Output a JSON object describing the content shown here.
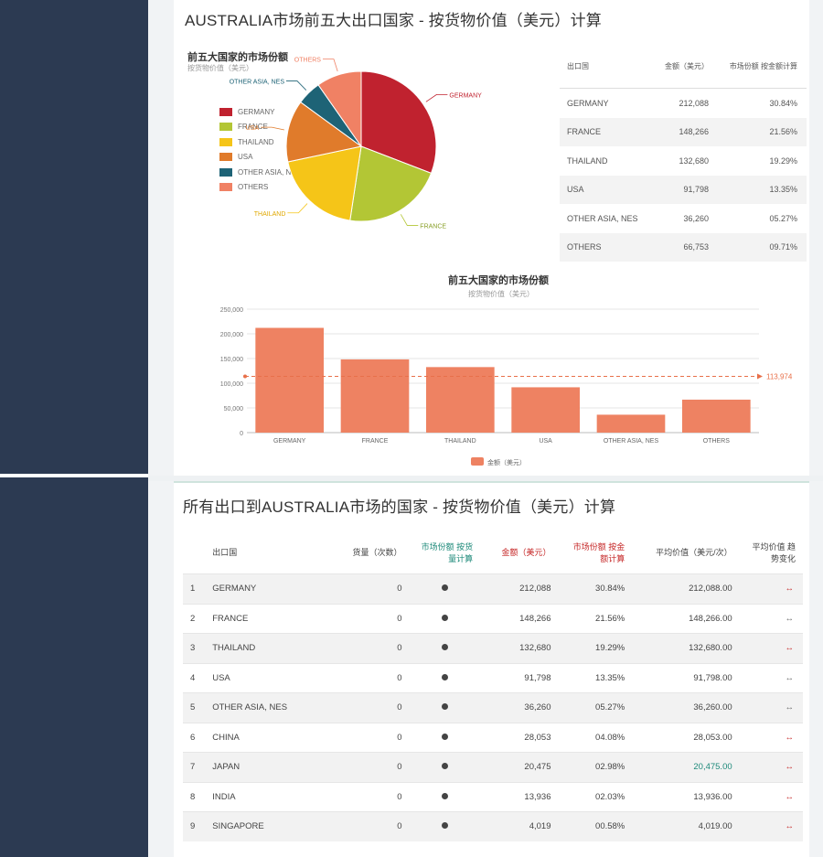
{
  "top_card": {
    "title": "AUSTRALIA市场前五大出口国家 - 按货物价值（美元）计算"
  },
  "pie": {
    "title": "前五大国家的市场份额",
    "subtitle": "按货物价值（美元）",
    "legend": [
      {
        "name": "GERMANY",
        "color": "#c0222f"
      },
      {
        "name": "FRANCE",
        "color": "#b3c635"
      },
      {
        "name": "THAILAND",
        "color": "#f5c518"
      },
      {
        "name": "USA",
        "color": "#e07b2b"
      },
      {
        "name": "OTHER ASIA, NES",
        "color": "#1e6376"
      },
      {
        "name": "OTHERS",
        "color": "#f08164"
      }
    ],
    "slice_labels": {
      "germany": "GERMANY",
      "france": "FRANCE",
      "thailand": "THAILAND",
      "usa": "USA",
      "other_asia": "OTHER ASIA, NES",
      "others": "OTHERS"
    }
  },
  "share_table": {
    "headers": {
      "country": "出口国",
      "value": "金额（美元）",
      "share": "市场份额 按金额计算"
    },
    "rows": [
      {
        "country": "GERMANY",
        "value": "212,088",
        "share": "30.84%"
      },
      {
        "country": "FRANCE",
        "value": "148,266",
        "share": "21.56%"
      },
      {
        "country": "THAILAND",
        "value": "132,680",
        "share": "19.29%"
      },
      {
        "country": "USA",
        "value": "91,798",
        "share": "13.35%"
      },
      {
        "country": "OTHER ASIA, NES",
        "value": "36,260",
        "share": "05.27%"
      },
      {
        "country": "OTHERS",
        "value": "66,753",
        "share": "09.71%"
      }
    ]
  },
  "bar": {
    "title": "前五大国家的市场份额",
    "subtitle": "按货物价值（美元）",
    "avg_label": "113,974",
    "legend_label": "金额（美元）",
    "color": "#ee8262"
  },
  "chart_data": {
    "type": "bar",
    "categories": [
      "GERMANY",
      "FRANCE",
      "THAILAND",
      "USA",
      "OTHER ASIA, NES",
      "OTHERS"
    ],
    "series": [
      {
        "name": "金额（美元）",
        "values": [
          212088,
          148266,
          132680,
          91798,
          36260,
          66753
        ]
      }
    ],
    "title": "前五大国家的市场份额",
    "subtitle": "按货物价值（美元）",
    "ylim": [
      0,
      250000
    ],
    "yticks": [
      0,
      50000,
      100000,
      150000,
      200000,
      250000
    ],
    "ytick_labels": [
      "0",
      "50,000",
      "100,000",
      "150,000",
      "200,000",
      "250,000"
    ],
    "mark_line": 113974,
    "legend_position": "bottom"
  },
  "bottom_card": {
    "title": "所有出口到AUSTRALIA市场的国家 - 按货物价值（美元）计算",
    "headers": {
      "country": "出口国",
      "count": "货量（次数）",
      "count_share": "市场份额 按货量计算",
      "value": "金额（美元）",
      "value_share": "市场份额 按金额计算",
      "avg": "平均价值（美元/次）",
      "avg_trend": "平均价值 趋势变化"
    },
    "rows": [
      {
        "idx": "1",
        "country": "GERMANY",
        "count": "0",
        "value": "212,088",
        "value_share": "30.84%",
        "avg": "212,088.00",
        "trend": "↔"
      },
      {
        "idx": "2",
        "country": "FRANCE",
        "count": "0",
        "value": "148,266",
        "value_share": "21.56%",
        "avg": "148,266.00",
        "trend": "↔"
      },
      {
        "idx": "3",
        "country": "THAILAND",
        "count": "0",
        "value": "132,680",
        "value_share": "19.29%",
        "avg": "132,680.00",
        "trend": "↔"
      },
      {
        "idx": "4",
        "country": "USA",
        "count": "0",
        "value": "91,798",
        "value_share": "13.35%",
        "avg": "91,798.00",
        "trend": "↔"
      },
      {
        "idx": "5",
        "country": "OTHER ASIA, NES",
        "count": "0",
        "value": "36,260",
        "value_share": "05.27%",
        "avg": "36,260.00",
        "trend": "↔"
      },
      {
        "idx": "6",
        "country": "CHINA",
        "count": "0",
        "value": "28,053",
        "value_share": "04.08%",
        "avg": "28,053.00",
        "trend": "↔"
      },
      {
        "idx": "7",
        "country": "JAPAN",
        "count": "0",
        "value": "20,475",
        "value_share": "02.98%",
        "avg": "20,475.00",
        "trend": "↔"
      },
      {
        "idx": "8",
        "country": "INDIA",
        "count": "0",
        "value": "13,936",
        "value_share": "02.03%",
        "avg": "13,936.00",
        "trend": "↔"
      },
      {
        "idx": "9",
        "country": "SINGAPORE",
        "count": "0",
        "value": "4,019",
        "value_share": "00.58%",
        "avg": "4,019.00",
        "trend": "↔"
      }
    ]
  }
}
